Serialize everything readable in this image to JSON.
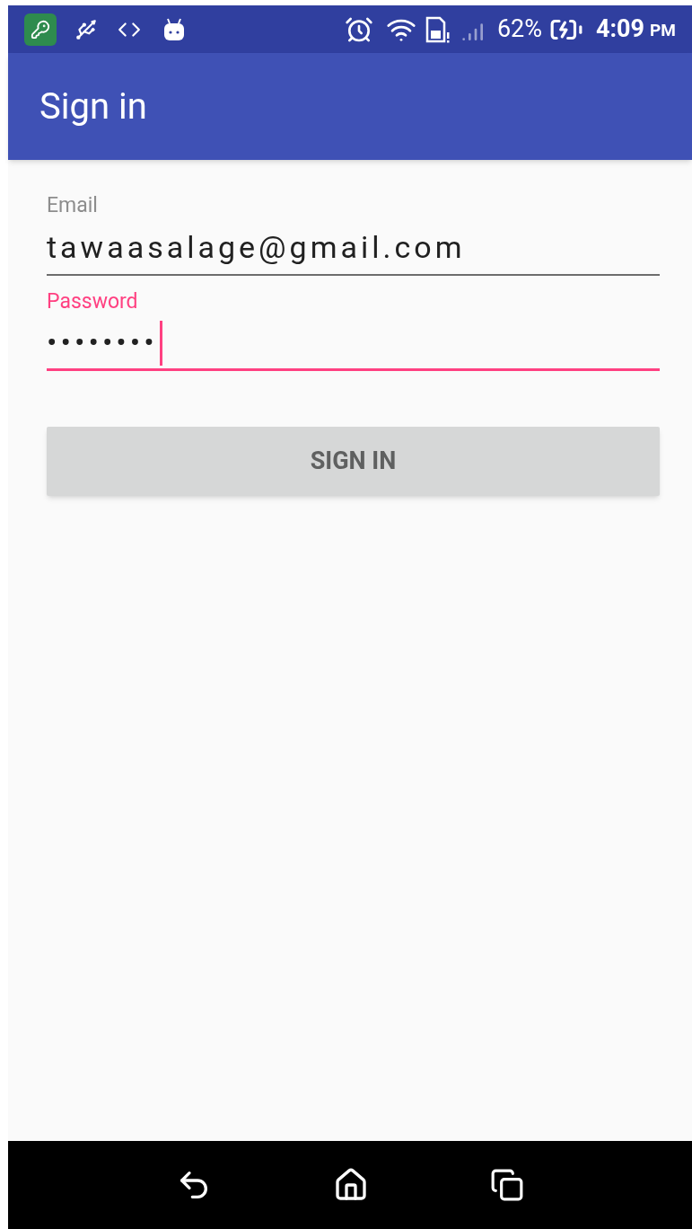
{
  "status_bar": {
    "battery": "62%",
    "time": "4:09",
    "time_suffix": "PM"
  },
  "app_bar": {
    "title": "Sign in"
  },
  "fields": [
    {
      "label": "Email",
      "value": "tawaasalage@gmail.com",
      "focused": false
    },
    {
      "label": "Password",
      "value": "••••••••",
      "focused": true
    }
  ],
  "button": {
    "label": "SIGN IN"
  }
}
